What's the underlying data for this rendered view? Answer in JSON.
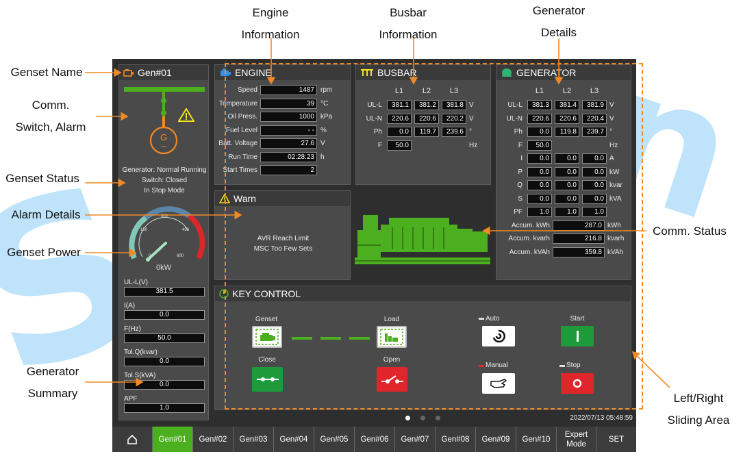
{
  "annotations": {
    "genset_name": "Genset Name",
    "comm_switch_1": "Comm.",
    "comm_switch_2": "Switch, Alarm",
    "genset_status": "Genset Status",
    "alarm_details": "Alarm Details",
    "genset_power": "Genset Power",
    "generator_summary_1": "Generator",
    "generator_summary_2": "Summary",
    "engine_info_1": "Engine",
    "engine_info_2": "Information",
    "busbar_info_1": "Busbar",
    "busbar_info_2": "Information",
    "generator_details_1": "Generator",
    "generator_details_2": "Details",
    "comm_status": "Comm. Status",
    "sliding_1": "Left/Right",
    "sliding_2": "Sliding Area"
  },
  "colors": {
    "accent": "#4caf1f",
    "orange": "#f08a24",
    "panel": "#4a4a4a",
    "red": "#e0262b",
    "green": "#1f9a3a"
  },
  "left": {
    "title": "Gen#01",
    "generator_symbol": "G",
    "generator_tilde": "~",
    "status": [
      "Generator: Normal Running",
      "Switch: Closed",
      "In Stop Mode"
    ],
    "gauge": {
      "ticks": [
        "0",
        "150",
        "300",
        "450",
        "600"
      ],
      "value_label": "0kW",
      "value_kw": 0
    },
    "summary": [
      {
        "label": "UL-L(V)",
        "value": "381.5"
      },
      {
        "label": "I(A)",
        "value": "0.0"
      },
      {
        "label": "F(Hz)",
        "value": "50.0"
      },
      {
        "label": "Tol.Q(kvar)",
        "value": "0.0"
      },
      {
        "label": "Tol.S(kVA)",
        "value": "0.0"
      },
      {
        "label": "APF",
        "value": "1.0"
      }
    ]
  },
  "engine": {
    "title": "ENGINE",
    "rows": [
      {
        "label": "Speed",
        "value": "1487",
        "unit": "rpm"
      },
      {
        "label": "Temperature",
        "value": "39",
        "unit": "°C"
      },
      {
        "label": "Oil Press.",
        "value": "1000",
        "unit": "kPa"
      },
      {
        "label": "Fuel Level",
        "value": "- -",
        "unit": "%"
      },
      {
        "label": "Batt. Voltage",
        "value": "27.6",
        "unit": "V"
      },
      {
        "label": "Run Time",
        "value": "02:28:23",
        "unit": "h"
      },
      {
        "label": "Start Times",
        "value": "2",
        "unit": ""
      }
    ]
  },
  "busbar": {
    "title": "BUSBAR",
    "cols": [
      "L1",
      "L2",
      "L3"
    ],
    "rows": [
      {
        "label": "UL-L",
        "values": [
          "381.1",
          "381.2",
          "381.8"
        ],
        "unit": "V"
      },
      {
        "label": "UL-N",
        "values": [
          "220.6",
          "220.6",
          "220.2"
        ],
        "unit": "V"
      },
      {
        "label": "Ph",
        "values": [
          "0.0",
          "119.7",
          "239.6"
        ],
        "unit": "°"
      }
    ],
    "freq": {
      "label": "F",
      "value": "50.0",
      "unit": "Hz"
    }
  },
  "generator": {
    "title": "GENERATOR",
    "cols": [
      "L1",
      "L2",
      "L3"
    ],
    "rows": [
      {
        "label": "UL-L",
        "values": [
          "381.3",
          "381.4",
          "381.9"
        ],
        "unit": "V"
      },
      {
        "label": "UL-N",
        "values": [
          "220.6",
          "220.6",
          "220.4"
        ],
        "unit": "V"
      },
      {
        "label": "Ph",
        "values": [
          "0.0",
          "119.8",
          "239.7"
        ],
        "unit": "°"
      }
    ],
    "freq": {
      "label": "F",
      "value": "50.0",
      "unit": "Hz"
    },
    "rows2": [
      {
        "label": "I",
        "values": [
          "0.0",
          "0.0",
          "0.0"
        ],
        "unit": "A"
      },
      {
        "label": "P",
        "values": [
          "0.0",
          "0.0",
          "0.0"
        ],
        "unit": "kW"
      },
      {
        "label": "Q",
        "values": [
          "0.0",
          "0.0",
          "0.0"
        ],
        "unit": "kvar"
      },
      {
        "label": "S",
        "values": [
          "0.0",
          "0.0",
          "0.0"
        ],
        "unit": "kVA"
      },
      {
        "label": "PF",
        "values": [
          "1.0",
          "1.0",
          "1.0"
        ],
        "unit": ""
      }
    ],
    "accum": [
      {
        "label": "Accum. kWh",
        "value": "287.0",
        "unit": "kWh"
      },
      {
        "label": "Accum. kvarh",
        "value": "216.8",
        "unit": "kvarh"
      },
      {
        "label": "Accum. kVAh",
        "value": "359.8",
        "unit": "kVAh"
      }
    ]
  },
  "warn": {
    "title": "Warn",
    "lines": [
      "AVR Reach Limit",
      "MSC Too Few Sets"
    ]
  },
  "key_control": {
    "title": "KEY CONTROL",
    "genset": "Genset",
    "load": "Load",
    "close": "Close",
    "open": "Open",
    "auto": "Auto",
    "manual": "Manual",
    "start": "Start",
    "stop": "Stop"
  },
  "timestamp": "2022/07/13 05:48:59",
  "nav": {
    "tabs": [
      "Gen#01",
      "Gen#02",
      "Gen#03",
      "Gen#04",
      "Gen#05",
      "Gen#06",
      "Gen#07",
      "Gen#08",
      "Gen#09",
      "Gen#10"
    ],
    "expert": "Expert Mode",
    "set": "SET"
  }
}
